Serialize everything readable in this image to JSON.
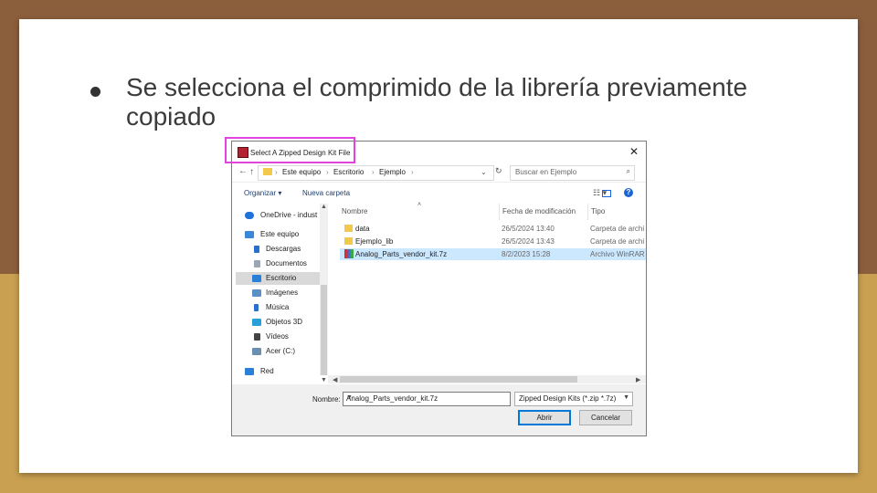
{
  "slide": {
    "bullet": "Se selecciona el comprimido de la librería previamente copiado"
  },
  "dialog": {
    "title": "Select A Zipped Design Kit File",
    "close": "✕",
    "nav": {
      "back": "←",
      "forward": "→",
      "down": "⌄",
      "up": "↑"
    },
    "breadcrumb": [
      "Este equipo",
      "Escritorio",
      "Ejemplo"
    ],
    "breadcrumb_sep": "›",
    "refresh": "↻",
    "search_placeholder": "Buscar en Ejemplo",
    "toolbar": {
      "organize": "Organizar ▾",
      "new_folder": "Nueva carpeta",
      "view": "☷ ▾",
      "help": "?"
    },
    "sidebar": {
      "items": [
        {
          "label": "OneDrive - indust",
          "icon": "cloud-icon",
          "color": "#1e73d8"
        },
        {
          "label": "Este equipo",
          "icon": "computer-icon",
          "color": "#3a88d8"
        },
        {
          "label": "Descargas",
          "icon": "download-icon",
          "color": "#2a6fc9"
        },
        {
          "label": "Documentos",
          "icon": "document-icon",
          "color": "#9aa6b2"
        },
        {
          "label": "Escritorio",
          "icon": "desktop-icon",
          "color": "#2a7fd6"
        },
        {
          "label": "Imágenes",
          "icon": "pictures-icon",
          "color": "#5b8fc6"
        },
        {
          "label": "Música",
          "icon": "music-icon",
          "color": "#2a6fc9"
        },
        {
          "label": "Objetos 3D",
          "icon": "3d-objects-icon",
          "color": "#2aa0d8"
        },
        {
          "label": "Vídeos",
          "icon": "videos-icon",
          "color": "#444444"
        },
        {
          "label": "Acer (C:)",
          "icon": "drive-icon",
          "color": "#6a8fb0"
        },
        {
          "label": "Red",
          "icon": "network-icon",
          "color": "#2a7fd6"
        }
      ],
      "selected": "Escritorio"
    },
    "columns": {
      "name": "Nombre",
      "modified": "Fecha de modificación",
      "type": "Tipo"
    },
    "files": [
      {
        "name": "data",
        "modified": "26/5/2024 13:40",
        "type": "Carpeta de archi",
        "icon": "folder-icon"
      },
      {
        "name": "Ejemplo_lib",
        "modified": "26/5/2024 13:43",
        "type": "Carpeta de archi",
        "icon": "folder-icon"
      },
      {
        "name": "Analog_Parts_vendor_kit.7z",
        "modified": "8/2/2023 15:28",
        "type": "Archivo WinRAR",
        "icon": "winrar-archive-icon",
        "selected": true
      }
    ],
    "filename_label": "Nombre:",
    "filename_value": "Analog_Parts_vendor_kit.7z",
    "filetype_value": "Zipped Design Kits (*.zip *.7z)",
    "open_button": "Abrir",
    "cancel_button": "Cancelar",
    "highlight_color": "#e044e0"
  }
}
